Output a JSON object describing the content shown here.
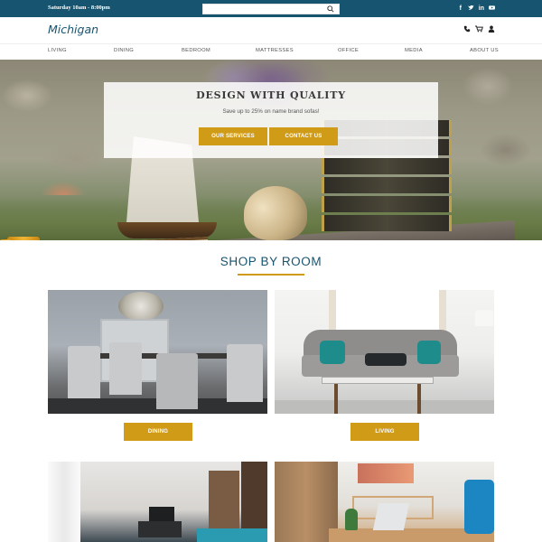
{
  "topbar": {
    "hours": "Saturday 10am - 8:00pm",
    "search_placeholder": "",
    "socials": [
      "f",
      "t",
      "in",
      "yt"
    ]
  },
  "header": {
    "brand": "Michigan",
    "icons": [
      "phone-icon",
      "cart-icon",
      "user-icon"
    ]
  },
  "nav": {
    "items": [
      "LIVING",
      "DINING",
      "BEDROOM",
      "MATTRESSES",
      "OFFICE",
      "MEDIA",
      "ABOUT US"
    ]
  },
  "hero": {
    "title": "DESIGN WITH QUALITY",
    "subtitle": "Save up to 25% on name brand sofas!",
    "services_label": "OUR SERVICES",
    "contact_label": "CONTACT US"
  },
  "shop": {
    "title": "SHOP BY ROOM",
    "rooms": [
      {
        "button": "DINING"
      },
      {
        "button": "LIVING"
      }
    ]
  },
  "colors": {
    "brand_blue": "#17546f",
    "gold": "#d09b16"
  }
}
